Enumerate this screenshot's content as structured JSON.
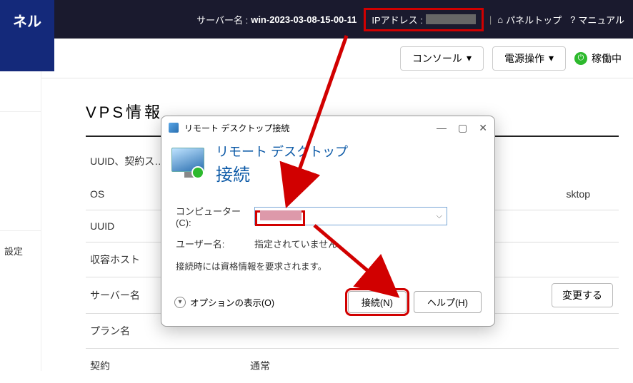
{
  "topbar": {
    "brand_fragment": "ネル",
    "server_name_label": "サーバー名 :",
    "server_name": "win-2023-03-08-15-00-11",
    "ip_label": "IPアドレス :",
    "panel_top": "パネルトップ",
    "manual": "マニュアル"
  },
  "subbar": {
    "console": "コンソール",
    "power": "電源操作",
    "status": "稼働中"
  },
  "sidebar": {
    "settings": "設定"
  },
  "main": {
    "heading": "VPS情報",
    "row0_label": "UUID、契約ス…",
    "rows": [
      {
        "k": "OS",
        "v": "sktop"
      },
      {
        "k": "UUID",
        "v": ""
      },
      {
        "k": "収容ホスト",
        "v": ""
      },
      {
        "k": "サーバー名",
        "v": "",
        "change": true
      },
      {
        "k": "プラン名",
        "v": ""
      },
      {
        "k": "契約",
        "v": "通常"
      }
    ],
    "change_btn": "変更する"
  },
  "dialog": {
    "title": "リモート デスクトップ接続",
    "hero_line1": "リモート デスクトップ",
    "hero_line2": "接続",
    "computer_label": "コンピューター(C):",
    "computer_dropdown_caret": "⌵",
    "user_label": "ユーザー名:",
    "user_value": "指定されていません",
    "note": "接続時には資格情報を要求されます。",
    "options": "オプションの表示(O)",
    "connect": "接続(N)",
    "help": "ヘルプ(H)",
    "win_min": "—",
    "win_max": "▢",
    "win_close": "✕"
  }
}
